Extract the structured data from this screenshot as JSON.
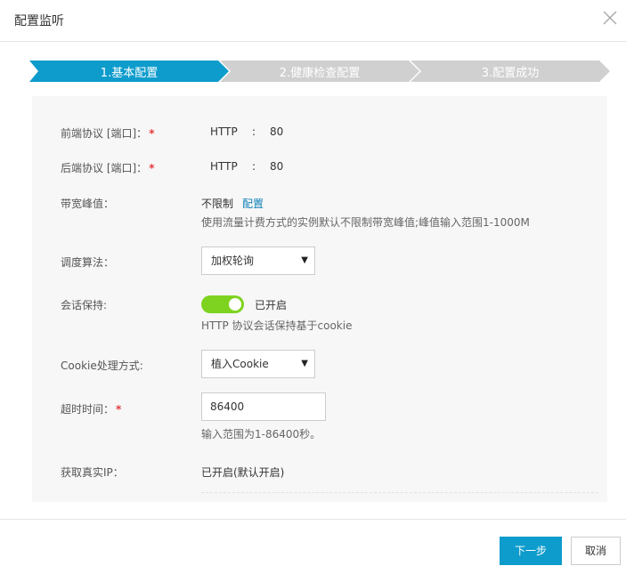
{
  "dialog": {
    "title": "配置监听"
  },
  "steps": [
    {
      "label": "1.基本配置",
      "color": "#0d9ccc"
    },
    {
      "label": "2.健康检查配置",
      "color": "#d0d0d0"
    },
    {
      "label": "3.配置成功",
      "color": "#d0d0d0"
    }
  ],
  "form": {
    "frontend": {
      "label": "前端协议 [端口]：",
      "required": "*",
      "protocol": "HTTP",
      "sep": ":",
      "port": "80"
    },
    "backend": {
      "label": "后端协议 [端口]：",
      "required": "*",
      "protocol": "HTTP",
      "sep": ":",
      "port": "80"
    },
    "bandwidth": {
      "label": "带宽峰值：",
      "value": "不限制",
      "link": "配置",
      "hint": "使用流量计费方式的实例默认不限制带宽峰值;峰值输入范围1-1000M"
    },
    "algorithm": {
      "label": "调度算法：",
      "selected": "加权轮询"
    },
    "session": {
      "label": "会话保持:",
      "status": "已开启",
      "hint": "HTTP 协议会话保持基于cookie",
      "enabled": true
    },
    "cookie": {
      "label": "Cookie处理方式:",
      "selected": "植入Cookie"
    },
    "timeout": {
      "label": "超时时间：",
      "required": "*",
      "value": "86400",
      "hint": "输入范围为1-86400秒。"
    },
    "realip": {
      "label": "获取真实IP：",
      "value": "已开启(默认开启)"
    }
  },
  "buttons": {
    "next": "下一步",
    "cancel": "取消"
  },
  "icons": {
    "close": "close-icon",
    "caret": "caret-down-icon",
    "toggle": "toggle-switch"
  }
}
